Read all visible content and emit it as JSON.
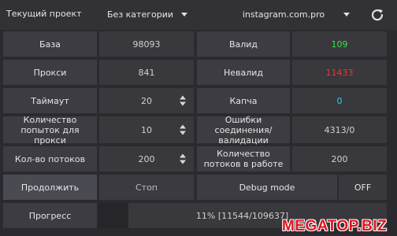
{
  "header": {
    "project_label": "Текущий проект",
    "category_value": "Без категории",
    "site_value": "instagram.com.pro"
  },
  "rows": {
    "base": {
      "label": "База",
      "value": "98093"
    },
    "valid": {
      "label": "Валид",
      "value": "109",
      "color": "#39e34a"
    },
    "proxy": {
      "label": "Прокси",
      "value": "841"
    },
    "invalid": {
      "label": "Невалид",
      "value": "11433",
      "color": "#e53935"
    },
    "timeout": {
      "label": "Таймаут",
      "value": "20"
    },
    "captcha": {
      "label": "Капча",
      "value": "0",
      "color": "#33d0e0"
    },
    "attempts": {
      "label": "Количество попыток для прокси",
      "value": "10"
    },
    "errors": {
      "label": "Ошибки соединения/валидации",
      "value": "4313/0"
    },
    "threads": {
      "label": "Кол-во потоков",
      "value": "200"
    },
    "threads_working": {
      "label": "Количество потоков в работе",
      "value": "200"
    }
  },
  "controls": {
    "continue_label": "Продолжить",
    "stop_label": "Стоп",
    "debug_label": "Debug mode",
    "debug_value": "OFF"
  },
  "progress": {
    "label": "Прогресс",
    "text": "11% [11544/109637]",
    "fraction": 0.105
  },
  "watermark": "MEGATOP.BIZ"
}
